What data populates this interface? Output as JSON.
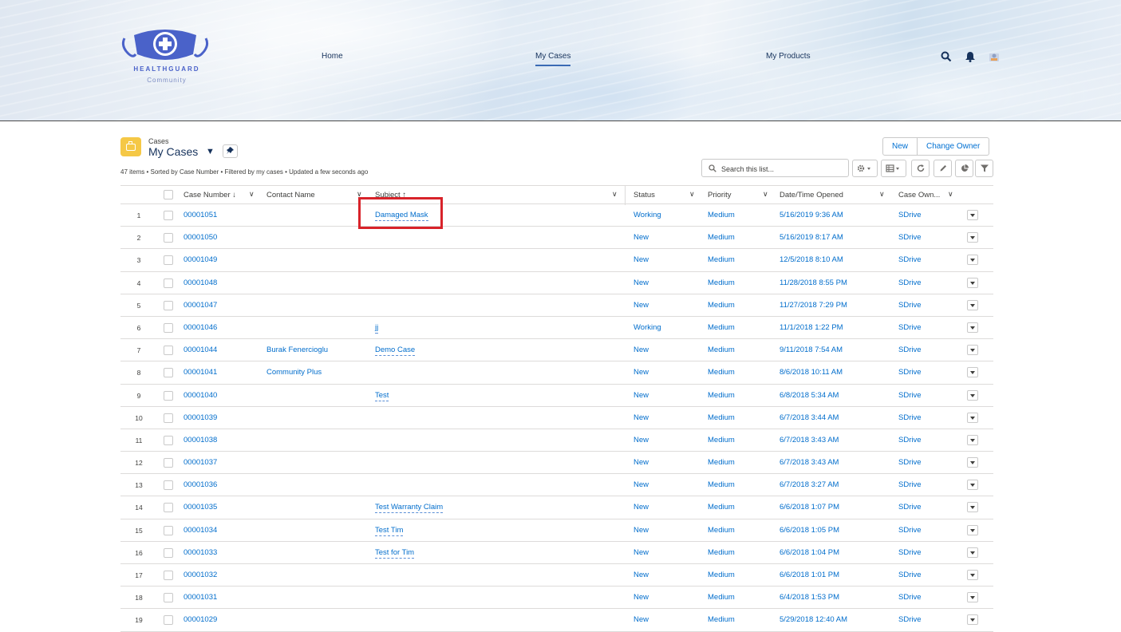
{
  "brand": {
    "name": "HEALTHGUARD",
    "sub": "Community",
    "colors": {
      "primary": "#4a62c9",
      "accent": "#0070d2",
      "highlight": "#d8232a",
      "list_icon": "#f5c846"
    }
  },
  "nav": {
    "home": "Home",
    "my_cases": "My Cases",
    "my_products": "My Products"
  },
  "header_icons": [
    "search-icon",
    "bell-icon",
    "user-avatar-icon"
  ],
  "list": {
    "object_type": "Cases",
    "title": "My Cases",
    "info": "47 items • Sorted by Case Number • Filtered by my cases • Updated a few seconds ago",
    "buttons": {
      "new": "New",
      "change_owner": "Change Owner"
    },
    "search_placeholder": "Search this list...",
    "toolbar_icons": [
      "gear-icon",
      "table-icon",
      "refresh-icon",
      "pencil-icon",
      "chart-icon",
      "filter-icon"
    ]
  },
  "columns": {
    "case_number": "Case Number",
    "contact_name": "Contact Name",
    "subject": "Subject",
    "status": "Status",
    "priority": "Priority",
    "date_opened": "Date/Time Opened",
    "case_owner": "Case Own..."
  },
  "rows": [
    {
      "n": "1",
      "case": "00001051",
      "contact": "",
      "subject": "Damaged Mask",
      "status": "Working",
      "priority": "Medium",
      "date": "5/16/2019 9:36 AM",
      "owner": "SDrive"
    },
    {
      "n": "2",
      "case": "00001050",
      "contact": "",
      "subject": "",
      "status": "New",
      "priority": "Medium",
      "date": "5/16/2019 8:17 AM",
      "owner": "SDrive"
    },
    {
      "n": "3",
      "case": "00001049",
      "contact": "",
      "subject": "",
      "status": "New",
      "priority": "Medium",
      "date": "12/5/2018 8:10 AM",
      "owner": "SDrive"
    },
    {
      "n": "4",
      "case": "00001048",
      "contact": "",
      "subject": "",
      "status": "New",
      "priority": "Medium",
      "date": "11/28/2018 8:55 PM",
      "owner": "SDrive"
    },
    {
      "n": "5",
      "case": "00001047",
      "contact": "",
      "subject": "",
      "status": "New",
      "priority": "Medium",
      "date": "11/27/2018 7:29 PM",
      "owner": "SDrive"
    },
    {
      "n": "6",
      "case": "00001046",
      "contact": "",
      "subject": "jj",
      "status": "Working",
      "priority": "Medium",
      "date": "11/1/2018 1:22 PM",
      "owner": "SDrive"
    },
    {
      "n": "7",
      "case": "00001044",
      "contact": "Burak Fenercioglu",
      "subject": "Demo Case",
      "status": "New",
      "priority": "Medium",
      "date": "9/11/2018 7:54 AM",
      "owner": "SDrive"
    },
    {
      "n": "8",
      "case": "00001041",
      "contact": "Community Plus",
      "subject": "",
      "status": "New",
      "priority": "Medium",
      "date": "8/6/2018 10:11 AM",
      "owner": "SDrive"
    },
    {
      "n": "9",
      "case": "00001040",
      "contact": "",
      "subject": "Test",
      "status": "New",
      "priority": "Medium",
      "date": "6/8/2018 5:34 AM",
      "owner": "SDrive"
    },
    {
      "n": "10",
      "case": "00001039",
      "contact": "",
      "subject": "",
      "status": "New",
      "priority": "Medium",
      "date": "6/7/2018 3:44 AM",
      "owner": "SDrive"
    },
    {
      "n": "11",
      "case": "00001038",
      "contact": "",
      "subject": "",
      "status": "New",
      "priority": "Medium",
      "date": "6/7/2018 3:43 AM",
      "owner": "SDrive"
    },
    {
      "n": "12",
      "case": "00001037",
      "contact": "",
      "subject": "",
      "status": "New",
      "priority": "Medium",
      "date": "6/7/2018 3:43 AM",
      "owner": "SDrive"
    },
    {
      "n": "13",
      "case": "00001036",
      "contact": "",
      "subject": "",
      "status": "New",
      "priority": "Medium",
      "date": "6/7/2018 3:27 AM",
      "owner": "SDrive"
    },
    {
      "n": "14",
      "case": "00001035",
      "contact": "",
      "subject": "Test Warranty Claim",
      "status": "New",
      "priority": "Medium",
      "date": "6/6/2018 1:07 PM",
      "owner": "SDrive"
    },
    {
      "n": "15",
      "case": "00001034",
      "contact": "",
      "subject": "Test Tim",
      "status": "New",
      "priority": "Medium",
      "date": "6/6/2018 1:05 PM",
      "owner": "SDrive"
    },
    {
      "n": "16",
      "case": "00001033",
      "contact": "",
      "subject": "Test for Tim",
      "status": "New",
      "priority": "Medium",
      "date": "6/6/2018 1:04 PM",
      "owner": "SDrive"
    },
    {
      "n": "17",
      "case": "00001032",
      "contact": "",
      "subject": "",
      "status": "New",
      "priority": "Medium",
      "date": "6/6/2018 1:01 PM",
      "owner": "SDrive"
    },
    {
      "n": "18",
      "case": "00001031",
      "contact": "",
      "subject": "",
      "status": "New",
      "priority": "Medium",
      "date": "6/4/2018 1:53 PM",
      "owner": "SDrive"
    },
    {
      "n": "19",
      "case": "00001029",
      "contact": "",
      "subject": "",
      "status": "New",
      "priority": "Medium",
      "date": "5/29/2018 12:40 AM",
      "owner": "SDrive"
    }
  ]
}
